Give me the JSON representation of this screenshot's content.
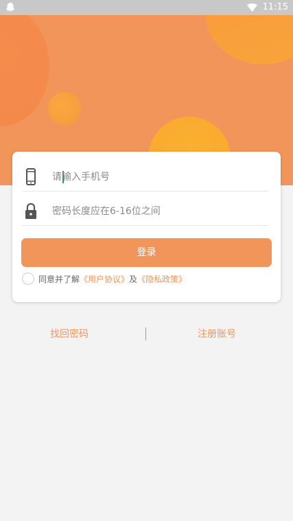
{
  "status_bar": {
    "time": "11:15"
  },
  "login_form": {
    "phone_placeholder": "请输入手机号",
    "password_placeholder": "密码长度应在6-16位之间",
    "login_label": "登录",
    "agreement_prefix": "同意并了解",
    "user_agreement": "《用户协议》",
    "agreement_and": "及",
    "privacy_policy": "《隐私政策》"
  },
  "bottom_links": {
    "forgot_password": "找回密码",
    "register": "注册账号"
  },
  "colors": {
    "accent": "#f2955a",
    "header": "#f2955a",
    "bubble_yellow": "#fbb030",
    "background": "#f3f3f3"
  },
  "icons": [
    "app-notification-icon",
    "wifi-icon",
    "phone-icon",
    "lock-icon"
  ]
}
